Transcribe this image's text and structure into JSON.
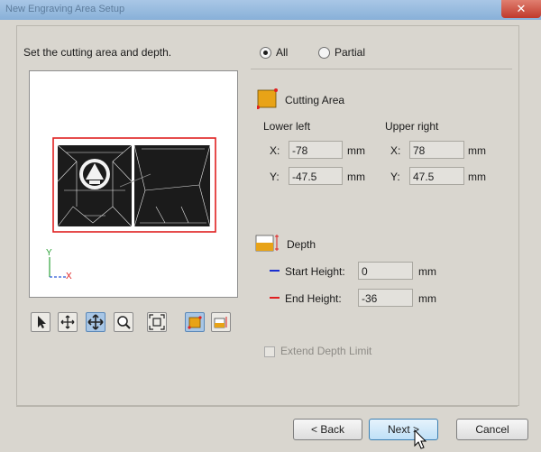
{
  "window": {
    "title": "New Engraving Area Setup",
    "close_glyph": "✕"
  },
  "instruction": "Set the cutting area and depth.",
  "mode": {
    "all_label": "All",
    "partial_label": "Partial",
    "selected": "All"
  },
  "cutting_area": {
    "label": "Cutting Area",
    "lower_left_label": "Lower left",
    "upper_right_label": "Upper right",
    "lower_left": {
      "x_label": "X:",
      "x": "-78",
      "y_label": "Y:",
      "y": "-47.5"
    },
    "upper_right": {
      "x_label": "X:",
      "x": "78",
      "y_label": "Y:",
      "y": "47.5"
    },
    "unit": "mm"
  },
  "depth": {
    "label": "Depth",
    "start_label": "Start Height:",
    "start_value": "0",
    "end_label": "End Height:",
    "end_value": "-36",
    "unit": "mm"
  },
  "extend_depth": {
    "label": "Extend Depth Limit",
    "checked": false
  },
  "axes": {
    "y": "Y",
    "x": "X"
  },
  "colors": {
    "accent": "#e8a317",
    "bbox": "#e02020",
    "start_line": "#1a2fd0",
    "end_line": "#e02020"
  },
  "toolbar": {
    "icons": [
      "pointer-icon",
      "pan-icon",
      "move-icon",
      "zoom-icon",
      "fit-icon",
      "cutting-area-icon",
      "depth-icon"
    ],
    "active": "move-icon"
  },
  "buttons": {
    "back": "< Back",
    "next": "Next >",
    "cancel": "Cancel"
  }
}
